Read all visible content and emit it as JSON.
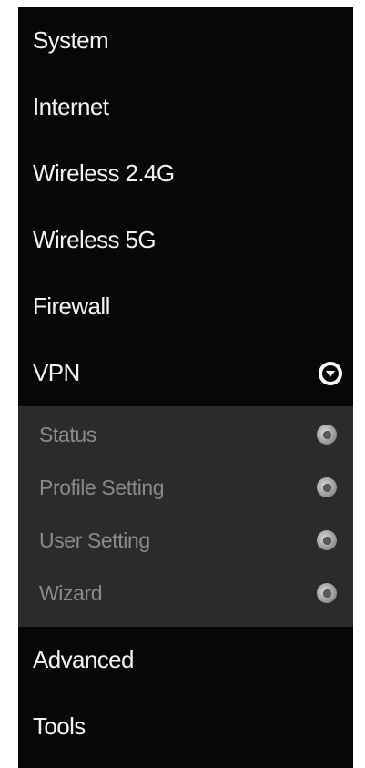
{
  "menu": {
    "items": [
      {
        "label": "System"
      },
      {
        "label": "Internet"
      },
      {
        "label": "Wireless 2.4G"
      },
      {
        "label": "Wireless 5G"
      },
      {
        "label": "Firewall"
      },
      {
        "label": "VPN",
        "expanded": true,
        "icon": "chevron-down-circle-icon"
      }
    ],
    "vpn_sub": [
      {
        "label": "Status",
        "icon": "radio-dot-icon"
      },
      {
        "label": "Profile Setting",
        "icon": "radio-dot-icon"
      },
      {
        "label": "User Setting",
        "icon": "radio-dot-icon"
      },
      {
        "label": "Wizard",
        "icon": "radio-dot-icon"
      }
    ],
    "items_after": [
      {
        "label": "Advanced"
      },
      {
        "label": "Tools"
      }
    ]
  },
  "colors": {
    "menu_bg": "#070707",
    "submenu_bg": "#2b2b2b",
    "menu_text": "#f2f2f2",
    "submenu_text": "#8a8a8a"
  }
}
